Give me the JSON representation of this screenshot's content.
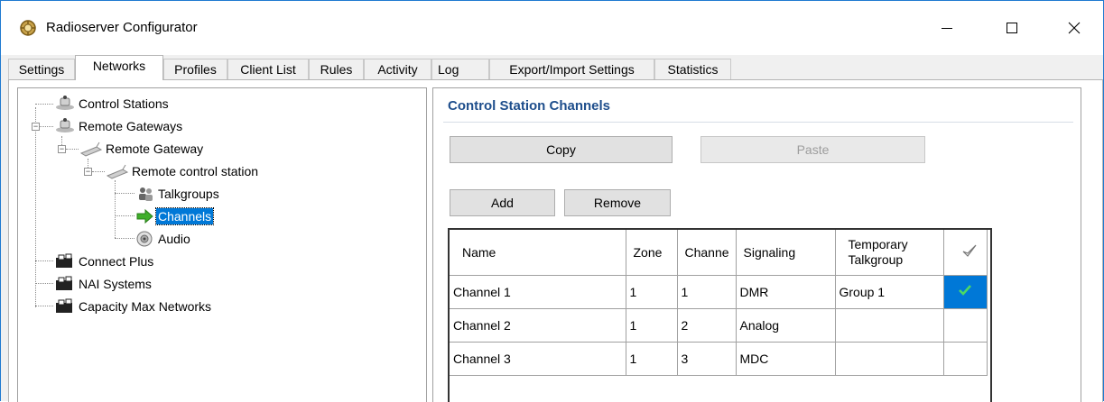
{
  "window": {
    "title": "Radioserver Configurator"
  },
  "tabs": [
    {
      "label": "Settings"
    },
    {
      "label": "Networks"
    },
    {
      "label": "Profiles"
    },
    {
      "label": "Client List"
    },
    {
      "label": "Rules"
    },
    {
      "label": "Activity"
    },
    {
      "label": "Log"
    },
    {
      "label": "Export/Import Settings"
    },
    {
      "label": "Statistics"
    }
  ],
  "tree": [
    {
      "label": "Control Stations"
    },
    {
      "label": "Remote Gateways"
    },
    {
      "label": "Remote Gateway"
    },
    {
      "label": "Remote control station"
    },
    {
      "label": "Talkgroups"
    },
    {
      "label": "Channels"
    },
    {
      "label": "Audio"
    },
    {
      "label": "Connect Plus"
    },
    {
      "label": "NAI Systems"
    },
    {
      "label": "Capacity Max Networks"
    }
  ],
  "panel": {
    "title": "Control Station Channels",
    "copy_label": "Copy",
    "paste_label": "Paste",
    "add_label": "Add",
    "remove_label": "Remove"
  },
  "grid": {
    "columns": [
      "Name",
      "Zone",
      "Channe",
      "Signaling",
      "Temporary Talkgroup"
    ],
    "rows": [
      {
        "name": "Channel 1",
        "zone": "1",
        "channel": "1",
        "signaling": "DMR",
        "talkgroup": "Group 1",
        "checked": true
      },
      {
        "name": "Channel 2",
        "zone": "1",
        "channel": "2",
        "signaling": "Analog",
        "talkgroup": "",
        "checked": false
      },
      {
        "name": "Channel 3",
        "zone": "1",
        "channel": "3",
        "signaling": "MDC",
        "talkgroup": "",
        "checked": false
      }
    ]
  },
  "colors": {
    "accent": "#0078d7",
    "section_title": "#1e4e8c",
    "check": "#4cd964"
  }
}
